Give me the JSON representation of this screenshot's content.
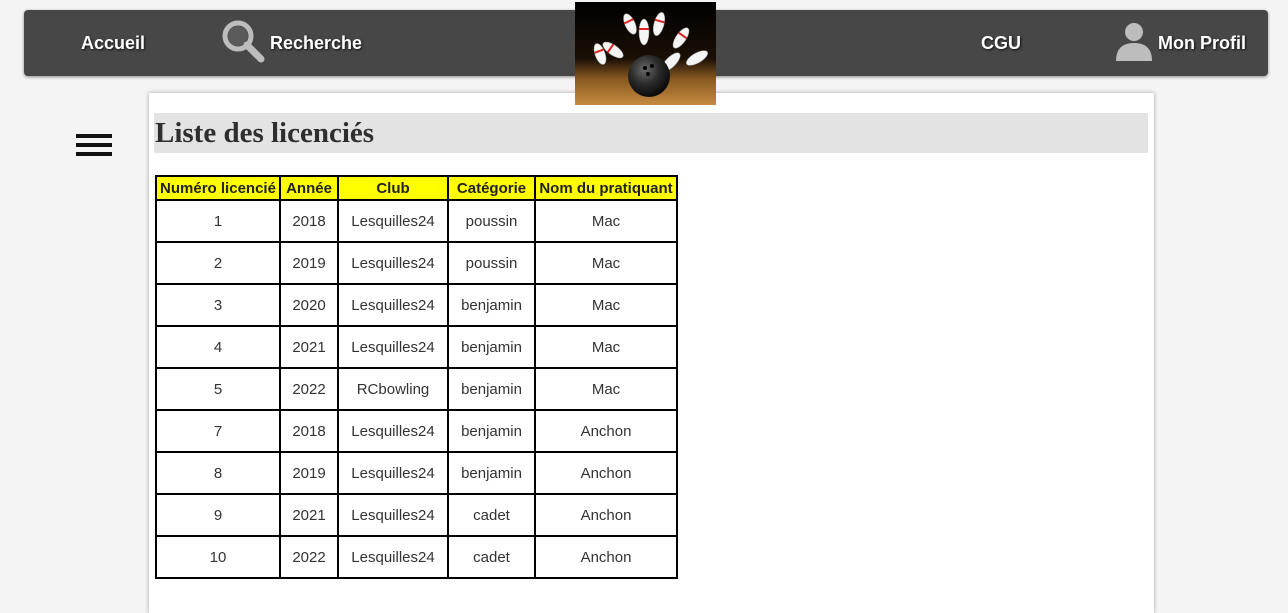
{
  "nav": {
    "accueil": "Accueil",
    "recherche": "Recherche",
    "cgu": "CGU",
    "profil": "Mon Profil"
  },
  "icons": {
    "search": "search-icon",
    "profile": "user-icon",
    "menu": "hamburger-menu-icon",
    "logo": "bowling-logo"
  },
  "colors": {
    "navbar": "#474747",
    "header_row": "#ffff00",
    "title_band": "#e3e3e3"
  },
  "page": {
    "title": "Liste des licenciés"
  },
  "table": {
    "headers": [
      "Numéro licencié",
      "Année",
      "Club",
      "Catégorie",
      "Nom du pratiquant"
    ],
    "rows": [
      [
        "1",
        "2018",
        "Lesquilles24",
        "poussin",
        "Mac"
      ],
      [
        "2",
        "2019",
        "Lesquilles24",
        "poussin",
        "Mac"
      ],
      [
        "3",
        "2020",
        "Lesquilles24",
        "benjamin",
        "Mac"
      ],
      [
        "4",
        "2021",
        "Lesquilles24",
        "benjamin",
        "Mac"
      ],
      [
        "5",
        "2022",
        "RCbowling",
        "benjamin",
        "Mac"
      ],
      [
        "7",
        "2018",
        "Lesquilles24",
        "benjamin",
        "Anchon"
      ],
      [
        "8",
        "2019",
        "Lesquilles24",
        "benjamin",
        "Anchon"
      ],
      [
        "9",
        "2021",
        "Lesquilles24",
        "cadet",
        "Anchon"
      ],
      [
        "10",
        "2022",
        "Lesquilles24",
        "cadet",
        "Anchon"
      ]
    ]
  }
}
